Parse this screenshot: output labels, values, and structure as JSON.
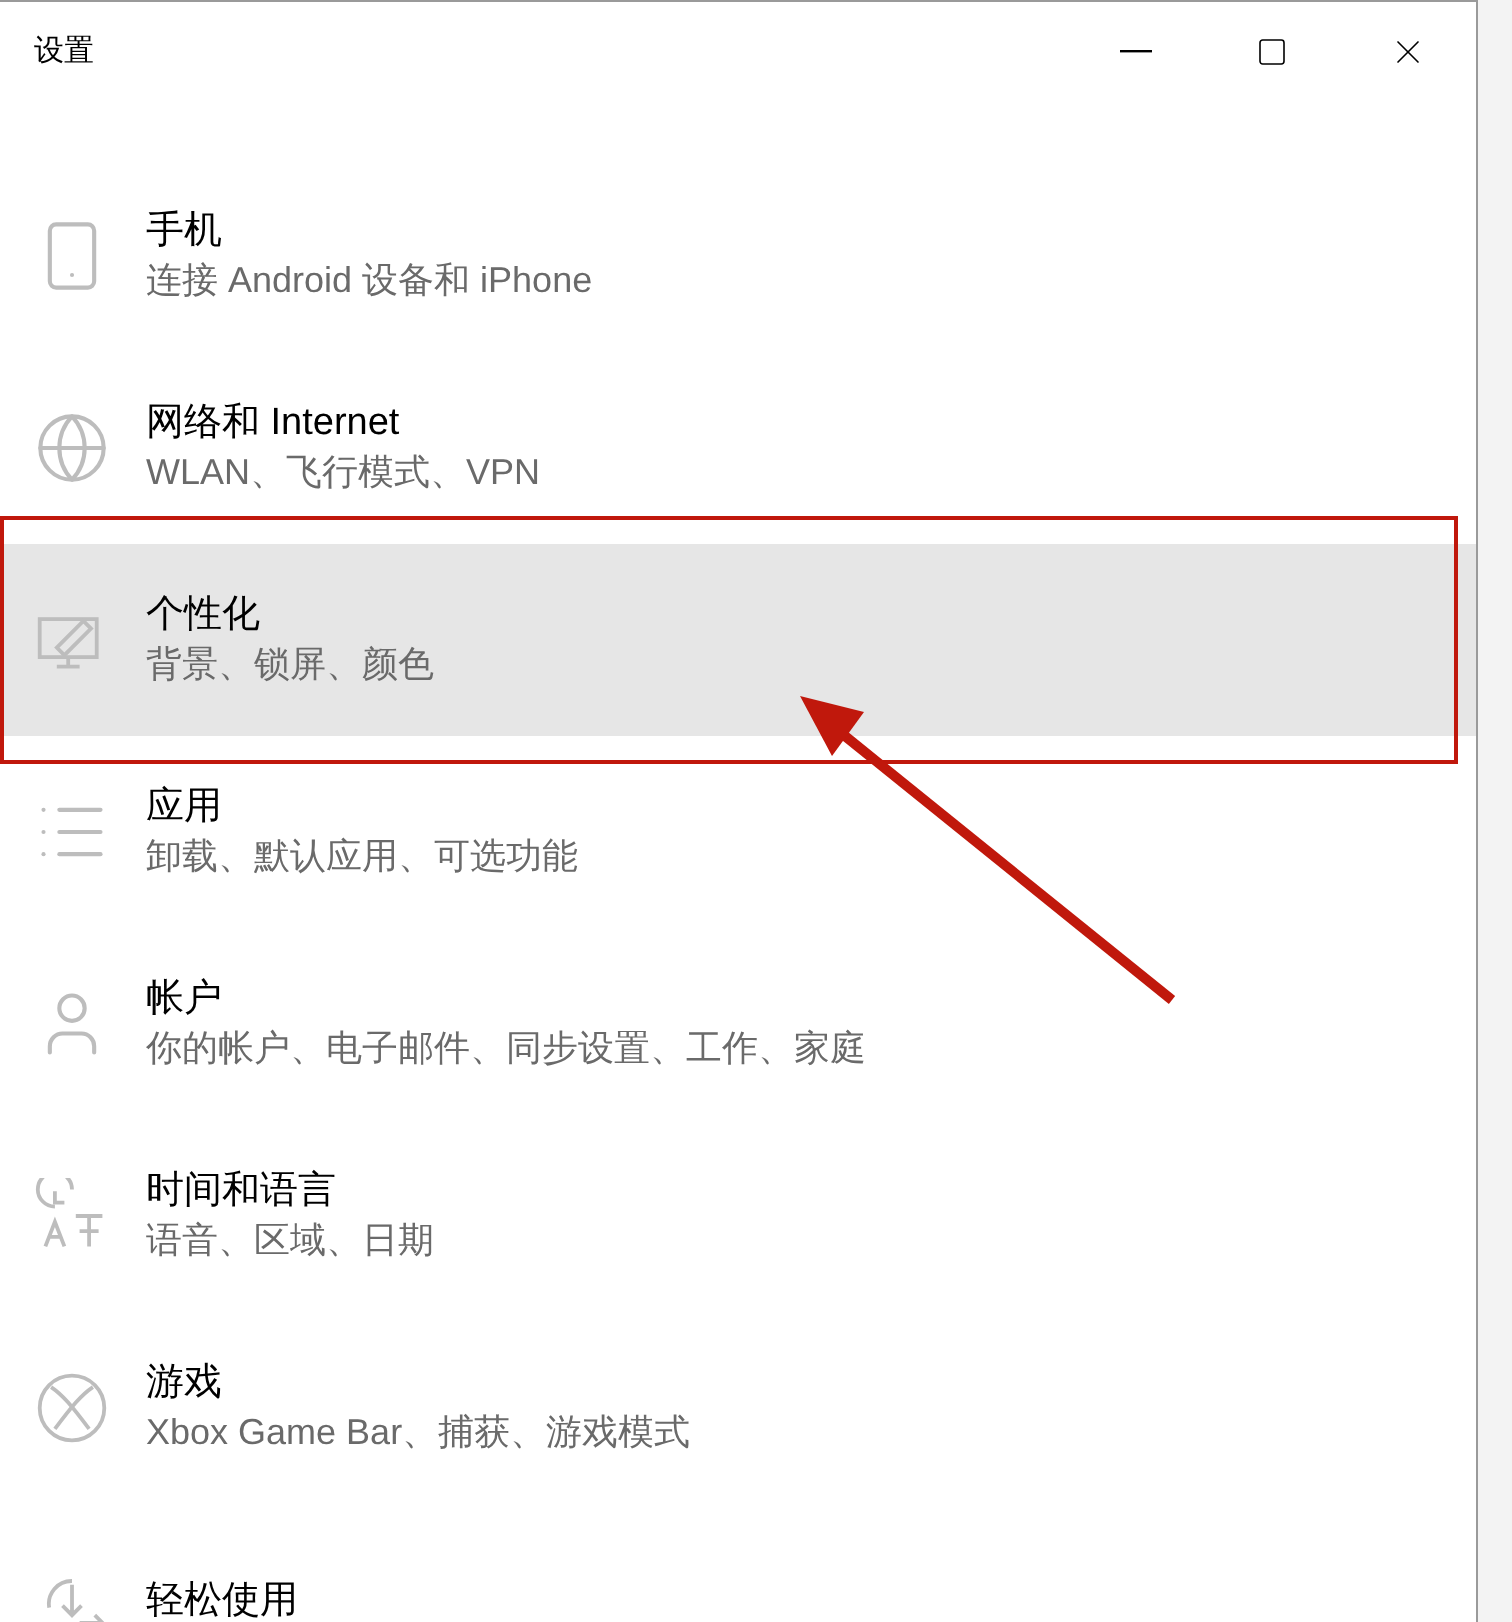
{
  "window": {
    "title": "设置"
  },
  "categories": [
    {
      "title": "手机",
      "subtitle": "连接 Android 设备和 iPhone",
      "selected": false
    },
    {
      "title": "网络和 Internet",
      "subtitle": "WLAN、飞行模式、VPN",
      "selected": false
    },
    {
      "title": "个性化",
      "subtitle": "背景、锁屏、颜色",
      "selected": true
    },
    {
      "title": "应用",
      "subtitle": "卸载、默认应用、可选功能",
      "selected": false
    },
    {
      "title": "帐户",
      "subtitle": "你的帐户、电子邮件、同步设置、工作、家庭",
      "selected": false
    },
    {
      "title": "时间和语言",
      "subtitle": "语音、区域、日期",
      "selected": false
    },
    {
      "title": "游戏",
      "subtitle": "Xbox Game Bar、捕获、游戏模式",
      "selected": false
    },
    {
      "title": "轻松使用",
      "selected": false
    }
  ]
}
